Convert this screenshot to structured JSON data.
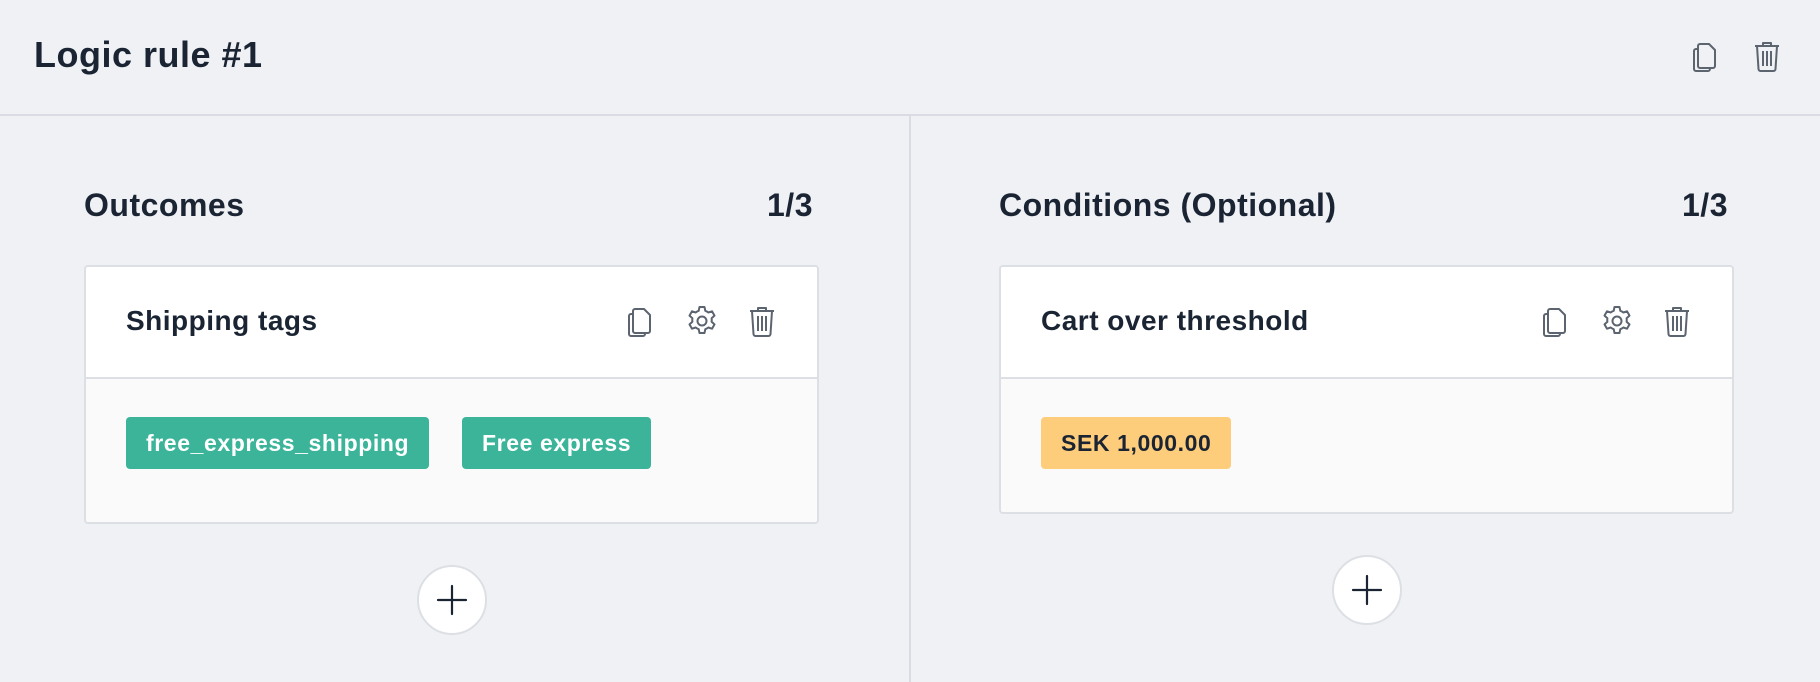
{
  "header": {
    "title": "Logic rule #1",
    "icons": [
      "copy-icon",
      "trash-icon"
    ]
  },
  "outcomes": {
    "heading": "Outcomes",
    "count": "1/3",
    "card": {
      "title": "Shipping tags",
      "icons": [
        "copy-icon",
        "gear-icon",
        "trash-icon"
      ],
      "tags": [
        "free_express_shipping",
        "Free express"
      ]
    },
    "add_icon": "plus-icon"
  },
  "conditions": {
    "heading": "Conditions (Optional)",
    "count": "1/3",
    "card": {
      "title": "Cart over threshold",
      "icons": [
        "copy-icon",
        "gear-icon",
        "trash-icon"
      ],
      "value": "SEK 1,000.00"
    },
    "add_icon": "plus-icon"
  },
  "colors": {
    "background": "#eff1f5",
    "tag_green": "#3bb49a",
    "tag_amber": "#fdcd7b",
    "text": "#1a2433",
    "icon": "#5c6470"
  }
}
